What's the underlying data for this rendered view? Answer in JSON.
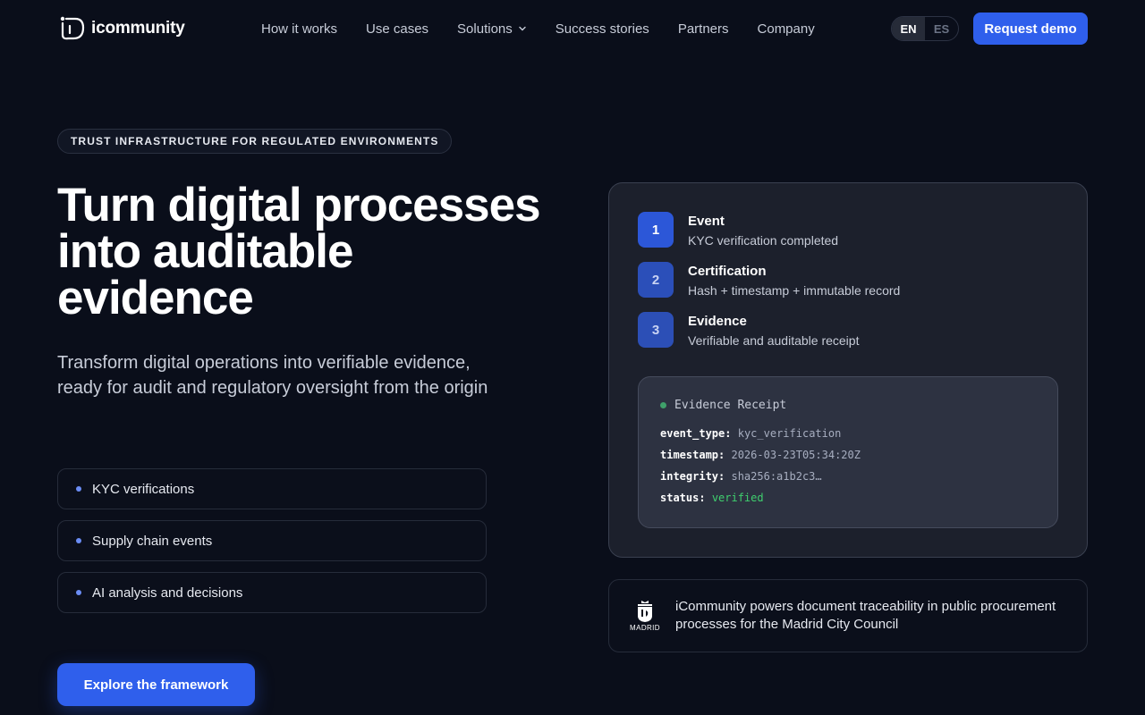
{
  "brand": {
    "name": "icommunity"
  },
  "nav": {
    "links": [
      "How it works",
      "Use cases",
      "Solutions",
      "Success stories",
      "Partners",
      "Company"
    ],
    "lang": {
      "options": [
        "EN",
        "ES"
      ],
      "selected": "EN"
    },
    "cta": "Request demo"
  },
  "hero": {
    "badge": "TRUST INFRASTRUCTURE FOR REGULATED ENVIRONMENTS",
    "title": "Turn digital processes into auditable evidence",
    "subtitle": "Transform digital operations into verifiable evidence, ready for audit and regulatory oversight from the origin",
    "use_cases": [
      "KYC verifications",
      "Supply chain events",
      "AI analysis and decisions"
    ],
    "cta": "Explore the framework"
  },
  "flow": {
    "steps": [
      {
        "num": "1",
        "title": "Event",
        "desc": "KYC verification completed"
      },
      {
        "num": "2",
        "title": "Certification",
        "desc": "Hash + timestamp + immutable record"
      },
      {
        "num": "3",
        "title": "Evidence",
        "desc": "Verifiable and auditable receipt"
      }
    ],
    "receipt": {
      "title": "Evidence Receipt",
      "rows": [
        {
          "key": "event_type:",
          "value": "kyc_verification"
        },
        {
          "key": "timestamp:",
          "value": "2026-03-23T05:34:20Z"
        },
        {
          "key": "integrity:",
          "value": "sha256:a1b2c3…"
        },
        {
          "key": "status:",
          "value": "verified"
        }
      ]
    }
  },
  "testimonial": {
    "logo_text": "MADRID",
    "text": "iCommunity powers document traceability in public procurement processes for the Madrid City Council"
  },
  "colors": {
    "accent": "#2f5fec",
    "background": "#0a0e1a",
    "status_ok": "#3fcf6e"
  }
}
